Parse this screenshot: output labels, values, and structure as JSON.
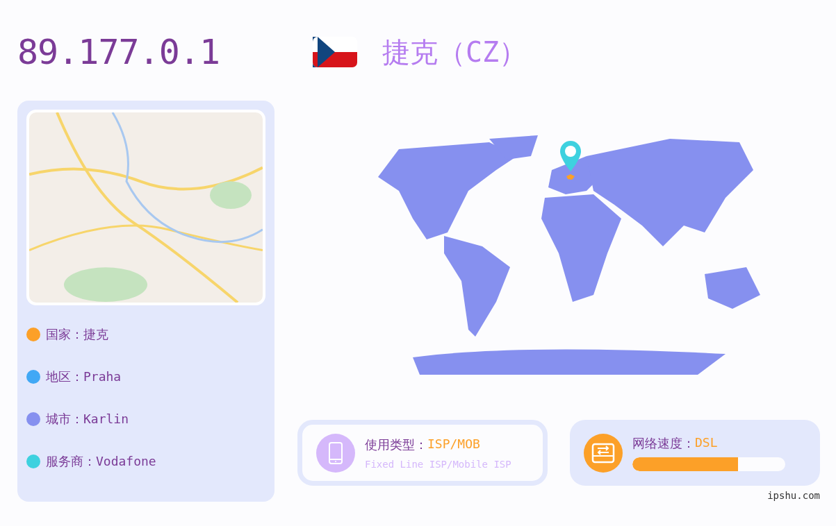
{
  "ip": "89.177.0.1",
  "country": {
    "name": "捷克",
    "code": "（CZ）"
  },
  "info_items": [
    {
      "text": "国家：捷克",
      "color": "#fca028"
    },
    {
      "text": "地区：Praha",
      "color": "#41a8f5"
    },
    {
      "text": "城市：Karlin",
      "color": "#8690ef"
    },
    {
      "text": "服务商：Vodafone",
      "color": "#3ed1df"
    }
  ],
  "usage_type": {
    "label": "使用类型：",
    "value": "ISP/MOB",
    "description": "Fixed Line ISP/Mobile ISP"
  },
  "network_speed": {
    "label": "网络速度：",
    "value": "DSL",
    "level": 0.69
  },
  "footer": "ipshu.com"
}
